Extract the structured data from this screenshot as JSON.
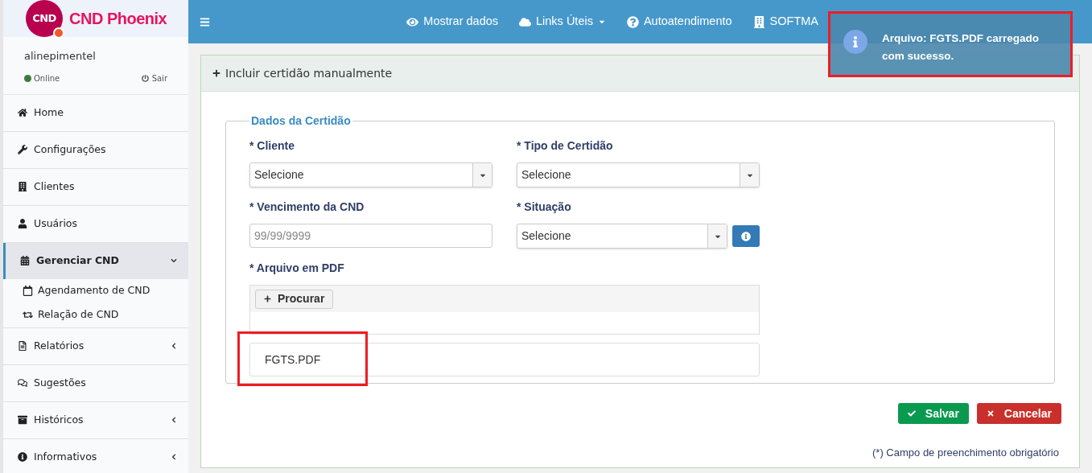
{
  "brand": {
    "logo_text": "CND",
    "name": "CND Phoenix"
  },
  "user": {
    "name": "alinepimentel",
    "status": "Online",
    "online": true,
    "logout": "Sair"
  },
  "sidebar": {
    "items": [
      {
        "label": "Home",
        "selected": false
      },
      {
        "label": "Configurações",
        "selected": false
      },
      {
        "label": "Clientes",
        "selected": false
      },
      {
        "label": "Usuários",
        "selected": false
      },
      {
        "label": "Gerenciar CND",
        "selected": true,
        "expanded": true,
        "children": [
          {
            "label": "Agendamento de CND"
          },
          {
            "label": "Relação de CND"
          }
        ]
      },
      {
        "label": "Relatórios",
        "selected": false,
        "expanded": false
      },
      {
        "label": "Sugestões",
        "selected": false
      },
      {
        "label": "Históricos",
        "selected": false,
        "expanded": false
      },
      {
        "label": "Informativos",
        "selected": false,
        "expanded": false
      }
    ]
  },
  "topbar": {
    "items": [
      {
        "label": "Mostrar dados",
        "dropdown": false
      },
      {
        "label": "Links Úteis",
        "dropdown": true
      },
      {
        "label": "Autoatendimento",
        "dropdown": false
      },
      {
        "label": "SOFTMA",
        "dropdown": false
      }
    ]
  },
  "toast": {
    "message": "Arquivo: FGTS.PDF carregado com sucesso.",
    "highlighted": true
  },
  "panel": {
    "title": "Incluir certidão manualmente",
    "fieldset": "Dados da Certidão",
    "fields": [
      {
        "kind": "select",
        "label": "* Cliente",
        "value": "Selecione"
      },
      {
        "kind": "select",
        "label": "* Tipo de Certidão",
        "value": "Selecione"
      },
      {
        "kind": "text",
        "label": "* Vencimento da CND",
        "placeholder": "99/99/9999"
      },
      {
        "kind": "select-info",
        "label": "* Situação",
        "value": "Selecione"
      }
    ],
    "upload": {
      "label": "* Arquivo em PDF",
      "button": "Procurar",
      "file": "FGTS.PDF",
      "highlighted": true
    },
    "buttons": [
      {
        "label": "Salvar",
        "kind": "save"
      },
      {
        "label": "Cancelar",
        "kind": "cancel"
      }
    ],
    "footnote": "(*) Campo de preenchimento obrigatório"
  }
}
